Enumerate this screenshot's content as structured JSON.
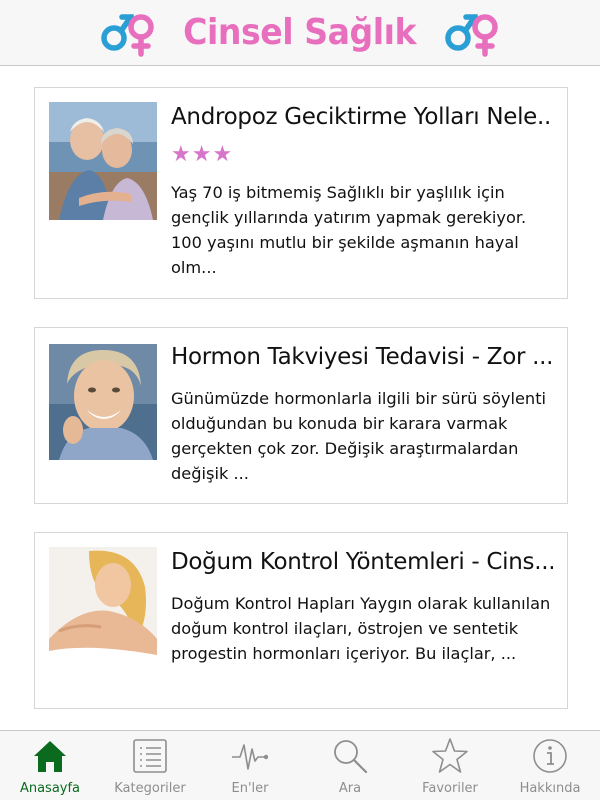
{
  "header": {
    "title": "Cinsel Sağlık",
    "left_icon": "male-female-symbol-icon",
    "right_icon": "male-female-symbol-icon",
    "colors": {
      "title": "#e86fbd",
      "male": "#2a9fd6",
      "female": "#e86fbd"
    }
  },
  "articles": [
    {
      "title": "Andropoz Geciktirme Yolları Nele...",
      "rating": "★★★",
      "excerpt": "Yaş 70 iş bitmemiş Sağlıklı bir yaşlılık için gençlik yıllarında yatırım yapmak gerekiyor. 100 yaşını mutlu bir şekilde aşmanın hayal olm..."
    },
    {
      "title": "Hormon Takviyesi Tedavisi - Zor ...",
      "excerpt": "Günümüzde hormonlarla ilgili bir sürü söylenti olduğundan bu konuda bir karara varmak gerçekten çok zor. Değişik araştırmalardan değişik ..."
    },
    {
      "title": "Doğum Kontrol Yöntemleri - Cins...",
      "excerpt": "Doğum Kontrol Hapları  Yaygın olarak kullanılan doğum kontrol ilaçları, östrojen ve sentetik progestin hormonları içeriyor. Bu ilaçlar, ..."
    }
  ],
  "tabbar": {
    "active_color": "#0a6b1f",
    "inactive_color": "#8e8e8e",
    "tabs": [
      {
        "label": "Anasayfa",
        "icon": "home-icon",
        "active": true
      },
      {
        "label": "Kategoriler",
        "icon": "list-icon",
        "active": false
      },
      {
        "label": "En'ler",
        "icon": "pulse-icon",
        "active": false
      },
      {
        "label": "Ara",
        "icon": "search-icon",
        "active": false
      },
      {
        "label": "Favoriler",
        "icon": "star-icon",
        "active": false
      },
      {
        "label": "Hakkında",
        "icon": "info-icon",
        "active": false
      }
    ]
  }
}
